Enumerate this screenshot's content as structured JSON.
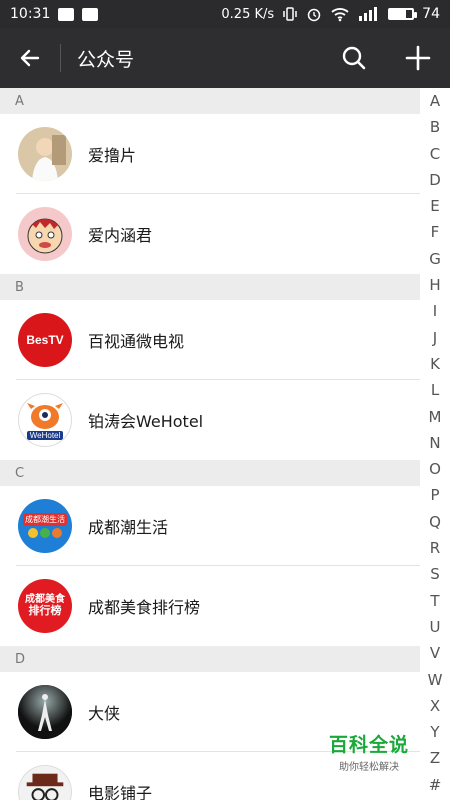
{
  "status_bar": {
    "time": "10:31",
    "net_speed": "0.25 K/s",
    "battery": "74"
  },
  "nav": {
    "title": "公众号"
  },
  "sections": [
    {
      "letter": "A",
      "items": [
        {
          "name": "爱撸片"
        },
        {
          "name": "爱内涵君"
        }
      ]
    },
    {
      "letter": "B",
      "items": [
        {
          "name": "百视通微电视",
          "avatar_text": "BesTV"
        },
        {
          "name": "铂涛会WeHotel",
          "avatar_text": "WeHotel"
        }
      ]
    },
    {
      "letter": "C",
      "items": [
        {
          "name": "成都潮生活",
          "avatar_text": "成都潮生活"
        },
        {
          "name": "成都美食排行榜",
          "avatar_text_1": "成都美食",
          "avatar_text_2": "排行榜"
        }
      ]
    },
    {
      "letter": "D",
      "items": [
        {
          "name": "大侠"
        },
        {
          "name": "电影铺子"
        }
      ]
    }
  ],
  "index_letters": [
    "A",
    "B",
    "C",
    "D",
    "E",
    "F",
    "G",
    "H",
    "I",
    "J",
    "K",
    "L",
    "M",
    "N",
    "O",
    "P",
    "Q",
    "R",
    "S",
    "T",
    "U",
    "V",
    "W",
    "X",
    "Y",
    "Z",
    "#"
  ],
  "watermark": {
    "title": "百科全说",
    "subtitle": "助你轻松解决"
  },
  "colors": {
    "navbar": "#2e2e30",
    "section_bg": "#ececec",
    "watermark_green": "#1aa83a"
  }
}
